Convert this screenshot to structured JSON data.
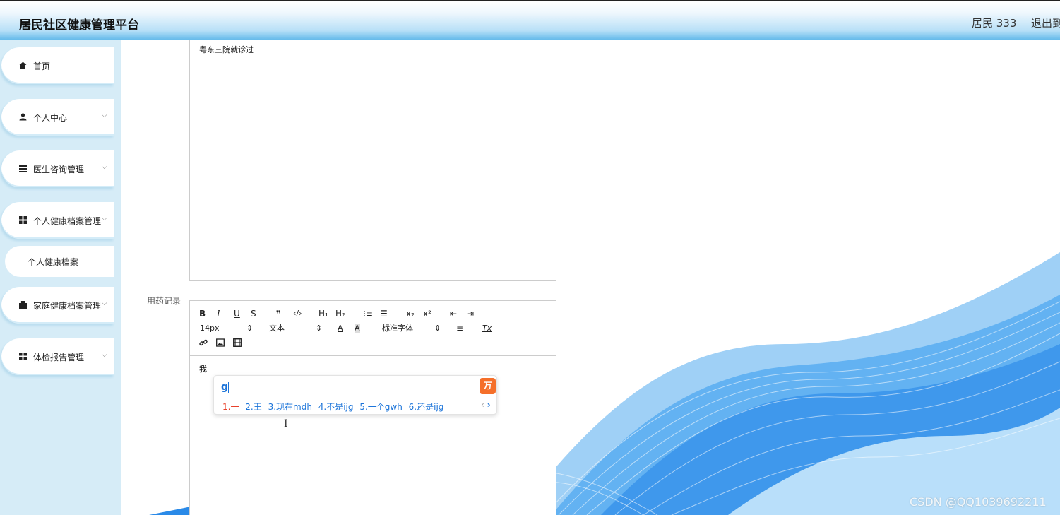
{
  "header": {
    "title": "居民社区健康管理平台",
    "user": "居民 333",
    "logout": "退出到"
  },
  "sidebar": {
    "items": [
      {
        "label": "首页",
        "icon": "home-icon"
      },
      {
        "label": "个人中心",
        "icon": "user-icon"
      },
      {
        "label": "医生咨询管理",
        "icon": "list-icon"
      },
      {
        "label": "个人健康档案管理",
        "icon": "grid-icon"
      },
      {
        "label": "家庭健康档案管理",
        "icon": "briefcase-icon"
      },
      {
        "label": "体检报告管理",
        "icon": "grid-icon"
      }
    ],
    "sub_item": "个人健康档案"
  },
  "editor1": {
    "content": "粤东三院就诊过"
  },
  "medication": {
    "label": "用药记录",
    "toolbar": {
      "bold": "B",
      "italic": "I",
      "underline": "U",
      "strike": "S",
      "quote": "❞",
      "code": "‹/›",
      "h1": "H₁",
      "h2": "H₂",
      "ordered": "⁝≡",
      "bullet": "☰",
      "sub": "x₂",
      "sup": "x²",
      "outdent": "⇤",
      "indent": "⇥",
      "font_size": "14px",
      "paragraph": "文本",
      "font_family": "标准字体",
      "color": "A",
      "background": "A",
      "align": "≡",
      "clear": "Tx"
    },
    "content": "我"
  },
  "ime": {
    "input": "g",
    "candidates": [
      "1.一",
      "2.王",
      "3.现在mdh",
      "4.不是ijg",
      "5.一个gwh",
      "6.还是ijg"
    ]
  },
  "watermark": "CSDN @QQ1039692211",
  "colors": {
    "header_gradient_end": "#5fb8ea",
    "sidebar_bg": "#d6ecf7",
    "ime_accent": "#1a73d9",
    "ime_first": "#e8402a",
    "ime_logo": "#f56f2a"
  }
}
